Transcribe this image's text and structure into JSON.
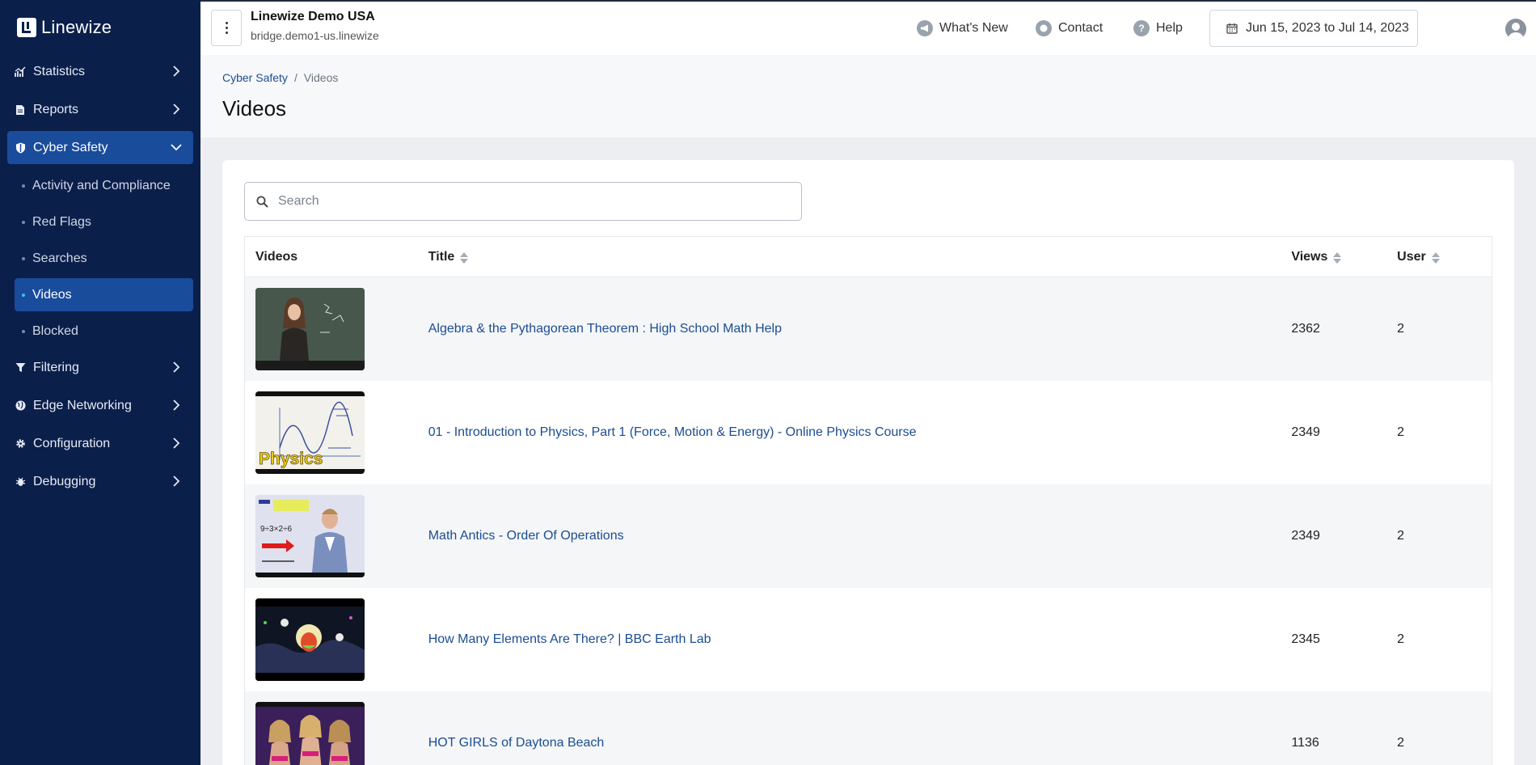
{
  "app": {
    "name": "Linewize"
  },
  "sidebar": {
    "items": [
      {
        "label": "Statistics"
      },
      {
        "label": "Reports"
      },
      {
        "label": "Cyber Safety"
      },
      {
        "label": "Filtering"
      },
      {
        "label": "Edge Networking"
      },
      {
        "label": "Configuration"
      },
      {
        "label": "Debugging"
      }
    ],
    "cyber_safety_sub": [
      {
        "label": "Activity and Compliance"
      },
      {
        "label": "Red Flags"
      },
      {
        "label": "Searches"
      },
      {
        "label": "Videos"
      },
      {
        "label": "Blocked"
      }
    ],
    "active_section": "Cyber Safety",
    "active_sub": "Videos"
  },
  "header": {
    "org_name": "Linewize Demo USA",
    "org_host": "bridge.demo1-us.linewize",
    "whats_new": "What's New",
    "contact": "Contact",
    "help": "Help",
    "date_range": "Jun 15, 2023 to Jul 14, 2023"
  },
  "breadcrumb": {
    "parent": "Cyber Safety",
    "separator": "/",
    "current": "Videos"
  },
  "page": {
    "title": "Videos"
  },
  "search": {
    "placeholder": "Search",
    "value": ""
  },
  "table": {
    "columns": {
      "videos": "Videos",
      "title": "Title",
      "views": "Views",
      "user": "User"
    },
    "rows": [
      {
        "title": "Algebra & the Pythagorean Theorem : High School Math Help",
        "views": "2362",
        "user": "2",
        "thumb_text": ""
      },
      {
        "title": "01 - Introduction to Physics, Part 1 (Force, Motion & Energy) - Online Physics Course",
        "views": "2349",
        "user": "2",
        "thumb_text": "Physics"
      },
      {
        "title": "Math Antics - Order Of Operations",
        "views": "2349",
        "user": "2",
        "thumb_text": "9÷3×2÷6"
      },
      {
        "title": "How Many Elements Are There? | BBC Earth Lab",
        "views": "2345",
        "user": "2",
        "thumb_text": ""
      },
      {
        "title": "HOT GIRLS of Daytona Beach",
        "views": "1136",
        "user": "2",
        "thumb_text": ""
      }
    ]
  },
  "colors": {
    "sidebar_bg": "#0b1f4b",
    "active_bg": "#1a4c9c",
    "link": "#1b4d92"
  }
}
